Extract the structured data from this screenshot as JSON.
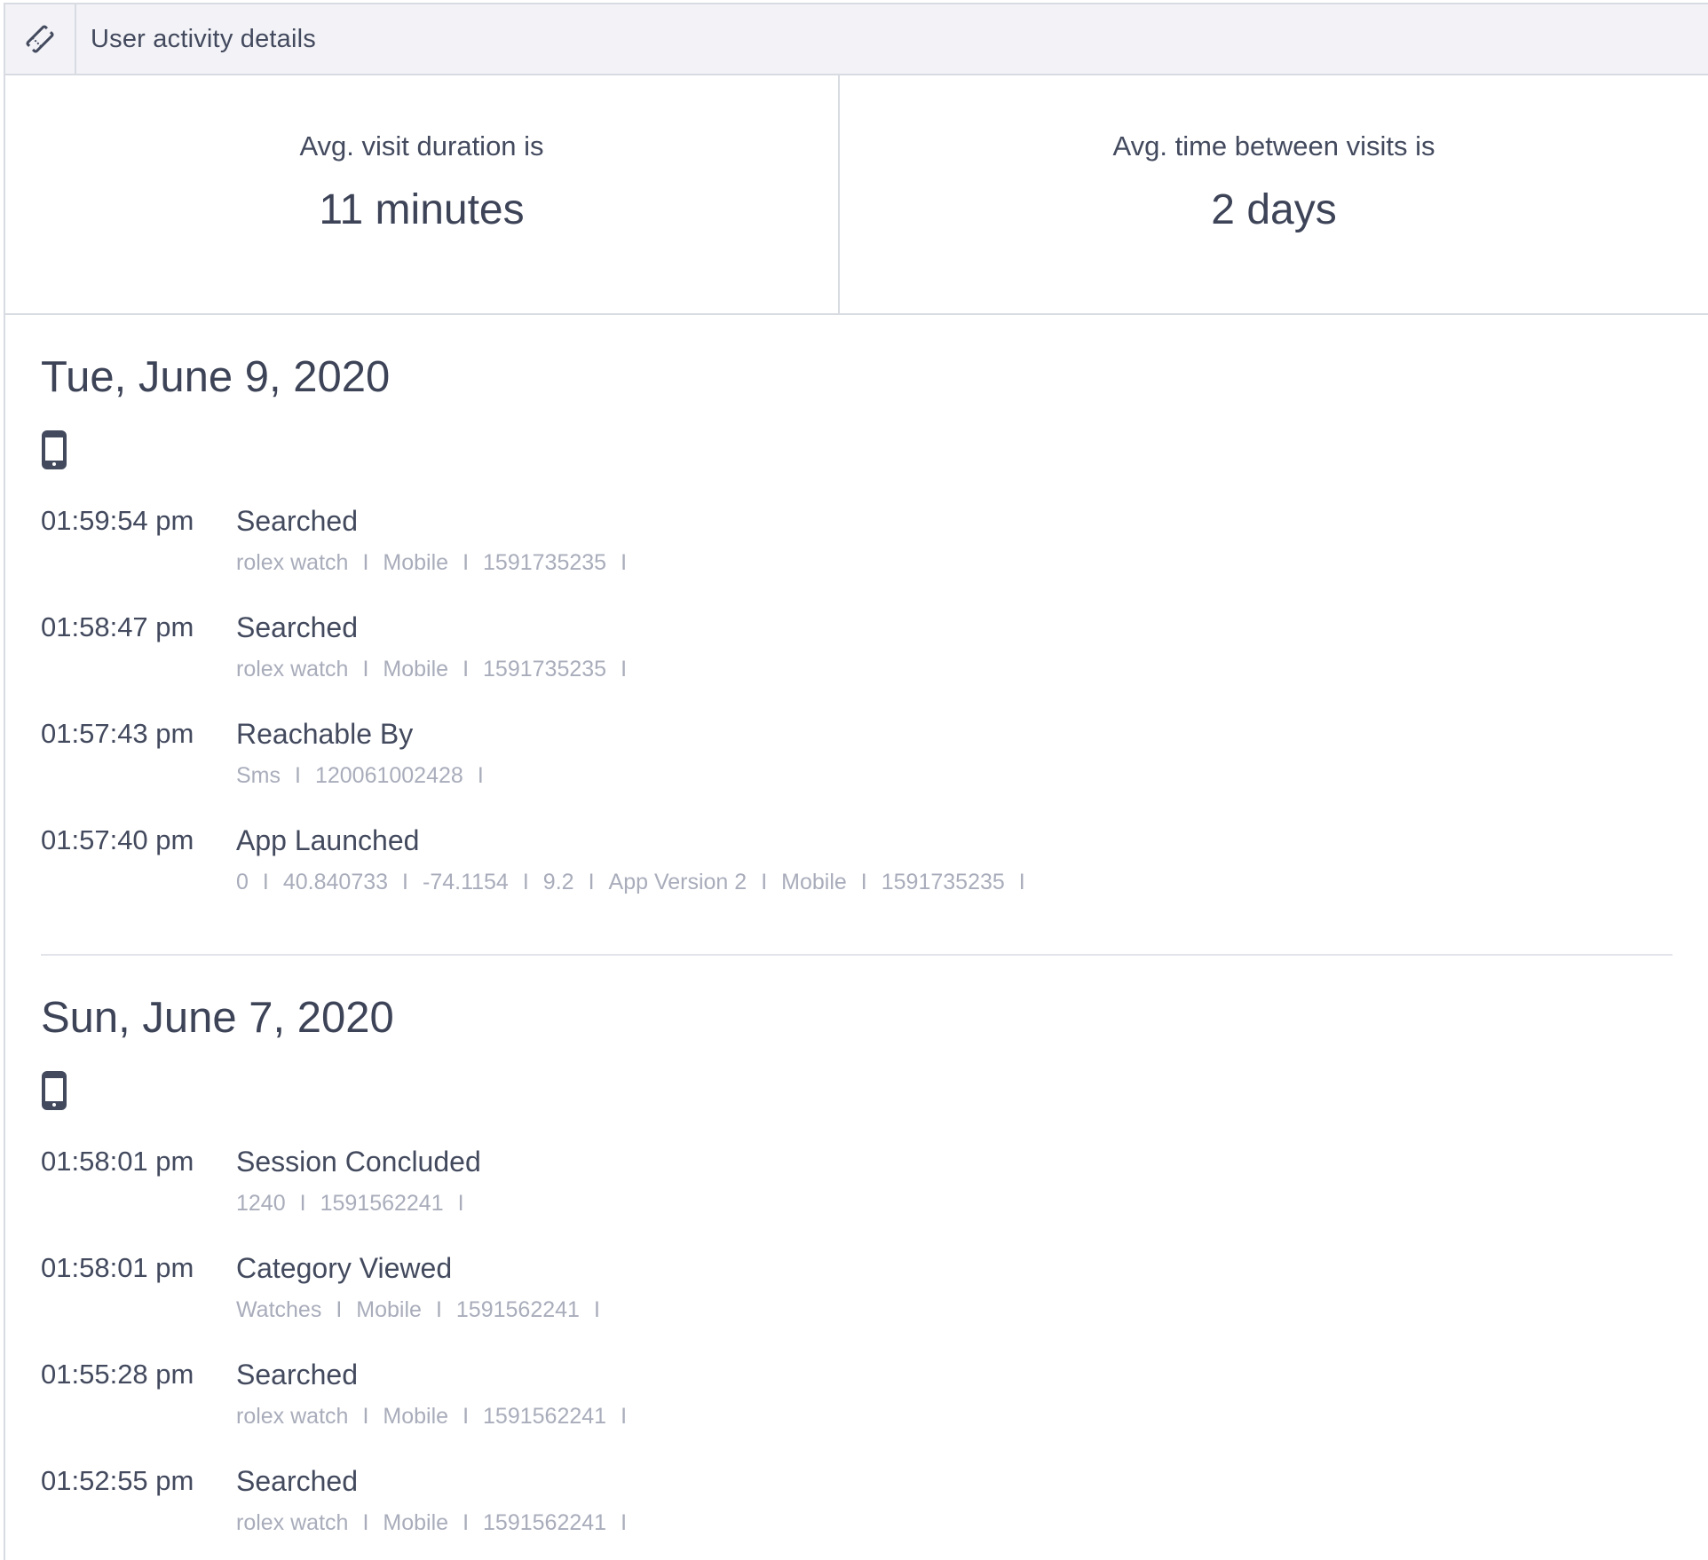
{
  "header": {
    "icon": "ticket-icon",
    "title": "User activity details"
  },
  "stats": {
    "visit_duration_label": "Avg. visit duration is",
    "visit_duration_value": "11 minutes",
    "time_between_label": "Avg. time between visits is",
    "time_between_value": "2 days"
  },
  "days": [
    {
      "date": "Tue, June 9, 2020",
      "device_icon": "mobile-phone-icon",
      "events": [
        {
          "time": "01:59:54 pm",
          "name": "Searched",
          "props": [
            "rolex watch",
            "Mobile",
            "1591735235"
          ]
        },
        {
          "time": "01:58:47 pm",
          "name": "Searched",
          "props": [
            "rolex watch",
            "Mobile",
            "1591735235"
          ]
        },
        {
          "time": "01:57:43 pm",
          "name": "Reachable By",
          "props": [
            "Sms",
            "120061002428"
          ]
        },
        {
          "time": "01:57:40 pm",
          "name": "App Launched",
          "props": [
            "0",
            "40.840733",
            "-74.1154",
            "9.2",
            "App Version 2",
            "Mobile",
            "1591735235"
          ]
        }
      ]
    },
    {
      "date": "Sun, June 7, 2020",
      "device_icon": "mobile-phone-icon",
      "events": [
        {
          "time": "01:58:01 pm",
          "name": "Session Concluded",
          "props": [
            "1240",
            "1591562241"
          ]
        },
        {
          "time": "01:58:01 pm",
          "name": "Category Viewed",
          "props": [
            "Watches",
            "Mobile",
            "1591562241"
          ]
        },
        {
          "time": "01:55:28 pm",
          "name": "Searched",
          "props": [
            "rolex watch",
            "Mobile",
            "1591562241"
          ]
        },
        {
          "time": "01:52:55 pm",
          "name": "Searched",
          "props": [
            "rolex watch",
            "Mobile",
            "1591562241"
          ]
        }
      ]
    }
  ],
  "separator": "I"
}
